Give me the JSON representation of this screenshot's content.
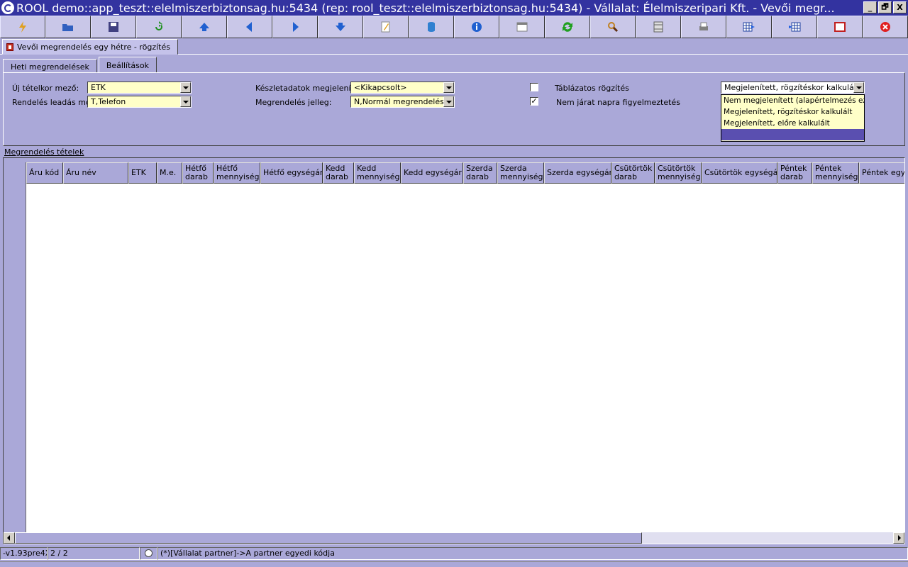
{
  "window": {
    "title": "ROOL demo::app_teszt::elelmiszerbiztonsag.hu:5434 (rep: rool_teszt::elelmiszerbiztonsag.hu:5434) - Vállalat: Élelmiszeripari Kft. - Vevői megr...",
    "buttons": [
      "_",
      "🗗",
      "X"
    ]
  },
  "toolbar": {
    "buttons": [
      {
        "name": "lightning-icon",
        "color": "#e0a020"
      },
      {
        "name": "open-folder-icon",
        "color": "#3060c0"
      },
      {
        "name": "save-disk-icon",
        "color": "#404080"
      },
      {
        "name": "refresh-arrow-icon",
        "color": "#209020"
      },
      {
        "name": "first-record-icon",
        "color": "#2060d0"
      },
      {
        "name": "previous-record-icon",
        "color": "#2060d0"
      },
      {
        "name": "next-record-icon",
        "color": "#2060d0"
      },
      {
        "name": "last-record-icon",
        "color": "#2060d0"
      },
      {
        "name": "edit-note-icon",
        "color": "#e0a020"
      },
      {
        "name": "database-icon",
        "color": "#3080d0"
      },
      {
        "name": "info-icon",
        "color": "#2060d0"
      },
      {
        "name": "form-view-icon",
        "color": "#808080"
      },
      {
        "name": "sync-icon",
        "color": "#20a020"
      },
      {
        "name": "search-magnifier-icon",
        "color": "#c08020"
      },
      {
        "name": "column-layout-icon",
        "color": "#606060"
      },
      {
        "name": "print-icon",
        "color": "#808080"
      },
      {
        "name": "grid-export-icon",
        "color": "#2040a0"
      },
      {
        "name": "grid-import-icon",
        "color": "#2040a0"
      },
      {
        "name": "fullscreen-icon",
        "color": "#c02020"
      },
      {
        "name": "close-circle-icon",
        "color": "#e02020"
      }
    ]
  },
  "doc_tab": {
    "label": "Vevői megrendelés egy hétre - rögzítés"
  },
  "inner_tabs": [
    {
      "label": "Heti megrendelések",
      "active": false
    },
    {
      "label": "Beállítások",
      "active": true
    }
  ],
  "settings": {
    "uj_tetelkor_label": "Új tételkor mező:",
    "uj_tetelkor_value": "ETK",
    "rendeles_mod_label": "Rendelés leadás mód:",
    "rendeles_mod_value": "T,Telefon",
    "keszlet_label": "Készletadatok megjelenítés:",
    "keszlet_value": "<Kikapcsolt>",
    "jelleg_label": "Megrendelés jelleg:",
    "jelleg_value": "N,Normál megrendelés",
    "tablazatos_label": "Táblázatos rögzítés",
    "tablazatos_checked": false,
    "nem_jarat_label": "Nem járat napra figyelmeztetés",
    "nem_jarat_checked": true,
    "kalkulacio_value": "Megjelenített, rögzítéskor kalkulált",
    "kalkulacio_options": [
      "Nem megjelenített     (alapértelmezés ez)",
      "Megjelenített, rögzítéskor kalkulált",
      "Megjelenített, előre kalkulált",
      ""
    ]
  },
  "grid": {
    "label": "Megrendelés tételek",
    "columns": [
      {
        "label": "Áru kód",
        "w": 52
      },
      {
        "label": "Áru név",
        "w": 92
      },
      {
        "label": "ETK",
        "w": 40
      },
      {
        "label": "M.e.",
        "w": 36
      },
      {
        "label": "Hétfő\ndarab",
        "w": 44
      },
      {
        "label": "Hétfő\nmennyiség",
        "w": 66
      },
      {
        "label": "Hétfő egységár",
        "w": 88
      },
      {
        "label": "Kedd\ndarab",
        "w": 44
      },
      {
        "label": "Kedd\nmennyiség",
        "w": 66
      },
      {
        "label": "Kedd egységár",
        "w": 88
      },
      {
        "label": "Szerda\ndarab",
        "w": 48
      },
      {
        "label": "Szerda\nmennyiség",
        "w": 66
      },
      {
        "label": "Szerda egységár",
        "w": 95
      },
      {
        "label": "Csütörtök\ndarab",
        "w": 61
      },
      {
        "label": "Csütörtök\nmennyiség",
        "w": 66
      },
      {
        "label": "Csütörtök egységár",
        "w": 107
      },
      {
        "label": "Péntek\ndarab",
        "w": 49
      },
      {
        "label": "Péntek\nmennyiség",
        "w": 66
      },
      {
        "label": "Péntek egys",
        "w": 70
      }
    ]
  },
  "status": {
    "version": "-v1.93pre4X",
    "page": "2 / 2",
    "hint": "(*)[Vállalat partner]->A partner egyedi kódja"
  }
}
